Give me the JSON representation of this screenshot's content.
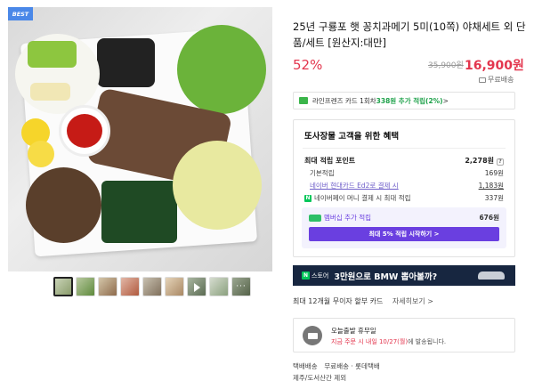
{
  "gallery": {
    "badge": "BEST",
    "thumbnail_count": 9,
    "more_thumbs_glyph": "···"
  },
  "product": {
    "title": "25년 구룡포 햇 꽁치과메기 5미(10쪽) 야채세트 외 단품/세트 [원산지:대만]",
    "discount": "52%",
    "original_price": "35,900원",
    "price": "16,900원",
    "shipping": "무료배송"
  },
  "card_promo": {
    "prefix": "라인프렌즈 카드 1회차 ",
    "highlight": "338원 추가 적립(2%)",
    "suffix": " >"
  },
  "benefits": {
    "title": "또사장물 고객을 위한 혜택",
    "max_points_label": "최대 적립 포인트",
    "max_points_value": "2,278원",
    "base_label": "기본적립",
    "base_value": "169원",
    "card_label": "네이버 현대카드 Ed2로 결제 시",
    "card_value": "1,183원",
    "npay_label": "네이버페이 머니 결제 시 최대 적립",
    "npay_value": "337원",
    "member_label": "멤버십 추가 적립",
    "member_value": "676원",
    "member_button": "최대 5% 적립 시작하기 >"
  },
  "banner": {
    "store_label": "스토어",
    "text": "3만원으로 BMW 뽑아볼까?"
  },
  "installment": {
    "text": "최대 12개월 무이자 할부 카드",
    "more": "자세히보기 >"
  },
  "delivery": {
    "title": "오늘출발 휴무일",
    "sub_prefix": "지금 주문 시 내일 10/27(월)",
    "sub_suffix": "에 발송됩니다."
  },
  "ship_info": {
    "method_key": "택배배송",
    "method_value": "무료배송 · 롯데택배",
    "exclusion": "제주/도서산간 제외"
  },
  "colors": {
    "accent_red": "#e3364e",
    "membership_purple": "#6a3fe0",
    "naver_green": "#03c75a",
    "banner_navy": "#172640"
  }
}
